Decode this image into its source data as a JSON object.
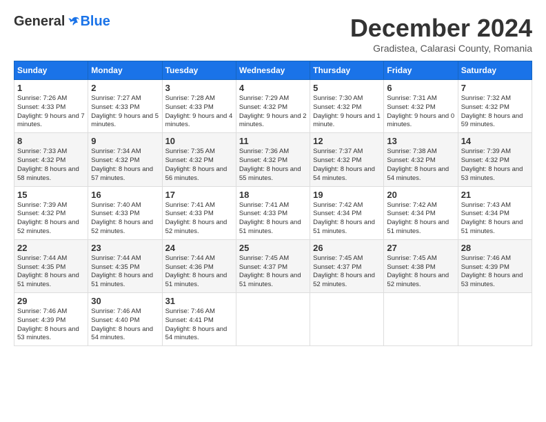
{
  "header": {
    "logo": {
      "general": "General",
      "blue": "Blue"
    },
    "month": "December 2024",
    "location": "Gradistea, Calarasi County, Romania"
  },
  "weekdays": [
    "Sunday",
    "Monday",
    "Tuesday",
    "Wednesday",
    "Thursday",
    "Friday",
    "Saturday"
  ],
  "weeks": [
    [
      {
        "day": "1",
        "sunrise": "Sunrise: 7:26 AM",
        "sunset": "Sunset: 4:33 PM",
        "daylight": "Daylight: 9 hours and 7 minutes."
      },
      {
        "day": "2",
        "sunrise": "Sunrise: 7:27 AM",
        "sunset": "Sunset: 4:33 PM",
        "daylight": "Daylight: 9 hours and 5 minutes."
      },
      {
        "day": "3",
        "sunrise": "Sunrise: 7:28 AM",
        "sunset": "Sunset: 4:33 PM",
        "daylight": "Daylight: 9 hours and 4 minutes."
      },
      {
        "day": "4",
        "sunrise": "Sunrise: 7:29 AM",
        "sunset": "Sunset: 4:32 PM",
        "daylight": "Daylight: 9 hours and 2 minutes."
      },
      {
        "day": "5",
        "sunrise": "Sunrise: 7:30 AM",
        "sunset": "Sunset: 4:32 PM",
        "daylight": "Daylight: 9 hours and 1 minute."
      },
      {
        "day": "6",
        "sunrise": "Sunrise: 7:31 AM",
        "sunset": "Sunset: 4:32 PM",
        "daylight": "Daylight: 9 hours and 0 minutes."
      },
      {
        "day": "7",
        "sunrise": "Sunrise: 7:32 AM",
        "sunset": "Sunset: 4:32 PM",
        "daylight": "Daylight: 8 hours and 59 minutes."
      }
    ],
    [
      {
        "day": "8",
        "sunrise": "Sunrise: 7:33 AM",
        "sunset": "Sunset: 4:32 PM",
        "daylight": "Daylight: 8 hours and 58 minutes."
      },
      {
        "day": "9",
        "sunrise": "Sunrise: 7:34 AM",
        "sunset": "Sunset: 4:32 PM",
        "daylight": "Daylight: 8 hours and 57 minutes."
      },
      {
        "day": "10",
        "sunrise": "Sunrise: 7:35 AM",
        "sunset": "Sunset: 4:32 PM",
        "daylight": "Daylight: 8 hours and 56 minutes."
      },
      {
        "day": "11",
        "sunrise": "Sunrise: 7:36 AM",
        "sunset": "Sunset: 4:32 PM",
        "daylight": "Daylight: 8 hours and 55 minutes."
      },
      {
        "day": "12",
        "sunrise": "Sunrise: 7:37 AM",
        "sunset": "Sunset: 4:32 PM",
        "daylight": "Daylight: 8 hours and 54 minutes."
      },
      {
        "day": "13",
        "sunrise": "Sunrise: 7:38 AM",
        "sunset": "Sunset: 4:32 PM",
        "daylight": "Daylight: 8 hours and 54 minutes."
      },
      {
        "day": "14",
        "sunrise": "Sunrise: 7:39 AM",
        "sunset": "Sunset: 4:32 PM",
        "daylight": "Daylight: 8 hours and 53 minutes."
      }
    ],
    [
      {
        "day": "15",
        "sunrise": "Sunrise: 7:39 AM",
        "sunset": "Sunset: 4:32 PM",
        "daylight": "Daylight: 8 hours and 52 minutes."
      },
      {
        "day": "16",
        "sunrise": "Sunrise: 7:40 AM",
        "sunset": "Sunset: 4:33 PM",
        "daylight": "Daylight: 8 hours and 52 minutes."
      },
      {
        "day": "17",
        "sunrise": "Sunrise: 7:41 AM",
        "sunset": "Sunset: 4:33 PM",
        "daylight": "Daylight: 8 hours and 52 minutes."
      },
      {
        "day": "18",
        "sunrise": "Sunrise: 7:41 AM",
        "sunset": "Sunset: 4:33 PM",
        "daylight": "Daylight: 8 hours and 51 minutes."
      },
      {
        "day": "19",
        "sunrise": "Sunrise: 7:42 AM",
        "sunset": "Sunset: 4:34 PM",
        "daylight": "Daylight: 8 hours and 51 minutes."
      },
      {
        "day": "20",
        "sunrise": "Sunrise: 7:42 AM",
        "sunset": "Sunset: 4:34 PM",
        "daylight": "Daylight: 8 hours and 51 minutes."
      },
      {
        "day": "21",
        "sunrise": "Sunrise: 7:43 AM",
        "sunset": "Sunset: 4:34 PM",
        "daylight": "Daylight: 8 hours and 51 minutes."
      }
    ],
    [
      {
        "day": "22",
        "sunrise": "Sunrise: 7:44 AM",
        "sunset": "Sunset: 4:35 PM",
        "daylight": "Daylight: 8 hours and 51 minutes."
      },
      {
        "day": "23",
        "sunrise": "Sunrise: 7:44 AM",
        "sunset": "Sunset: 4:35 PM",
        "daylight": "Daylight: 8 hours and 51 minutes."
      },
      {
        "day": "24",
        "sunrise": "Sunrise: 7:44 AM",
        "sunset": "Sunset: 4:36 PM",
        "daylight": "Daylight: 8 hours and 51 minutes."
      },
      {
        "day": "25",
        "sunrise": "Sunrise: 7:45 AM",
        "sunset": "Sunset: 4:37 PM",
        "daylight": "Daylight: 8 hours and 51 minutes."
      },
      {
        "day": "26",
        "sunrise": "Sunrise: 7:45 AM",
        "sunset": "Sunset: 4:37 PM",
        "daylight": "Daylight: 8 hours and 52 minutes."
      },
      {
        "day": "27",
        "sunrise": "Sunrise: 7:45 AM",
        "sunset": "Sunset: 4:38 PM",
        "daylight": "Daylight: 8 hours and 52 minutes."
      },
      {
        "day": "28",
        "sunrise": "Sunrise: 7:46 AM",
        "sunset": "Sunset: 4:39 PM",
        "daylight": "Daylight: 8 hours and 53 minutes."
      }
    ],
    [
      {
        "day": "29",
        "sunrise": "Sunrise: 7:46 AM",
        "sunset": "Sunset: 4:39 PM",
        "daylight": "Daylight: 8 hours and 53 minutes."
      },
      {
        "day": "30",
        "sunrise": "Sunrise: 7:46 AM",
        "sunset": "Sunset: 4:40 PM",
        "daylight": "Daylight: 8 hours and 54 minutes."
      },
      {
        "day": "31",
        "sunrise": "Sunrise: 7:46 AM",
        "sunset": "Sunset: 4:41 PM",
        "daylight": "Daylight: 8 hours and 54 minutes."
      },
      null,
      null,
      null,
      null
    ]
  ]
}
